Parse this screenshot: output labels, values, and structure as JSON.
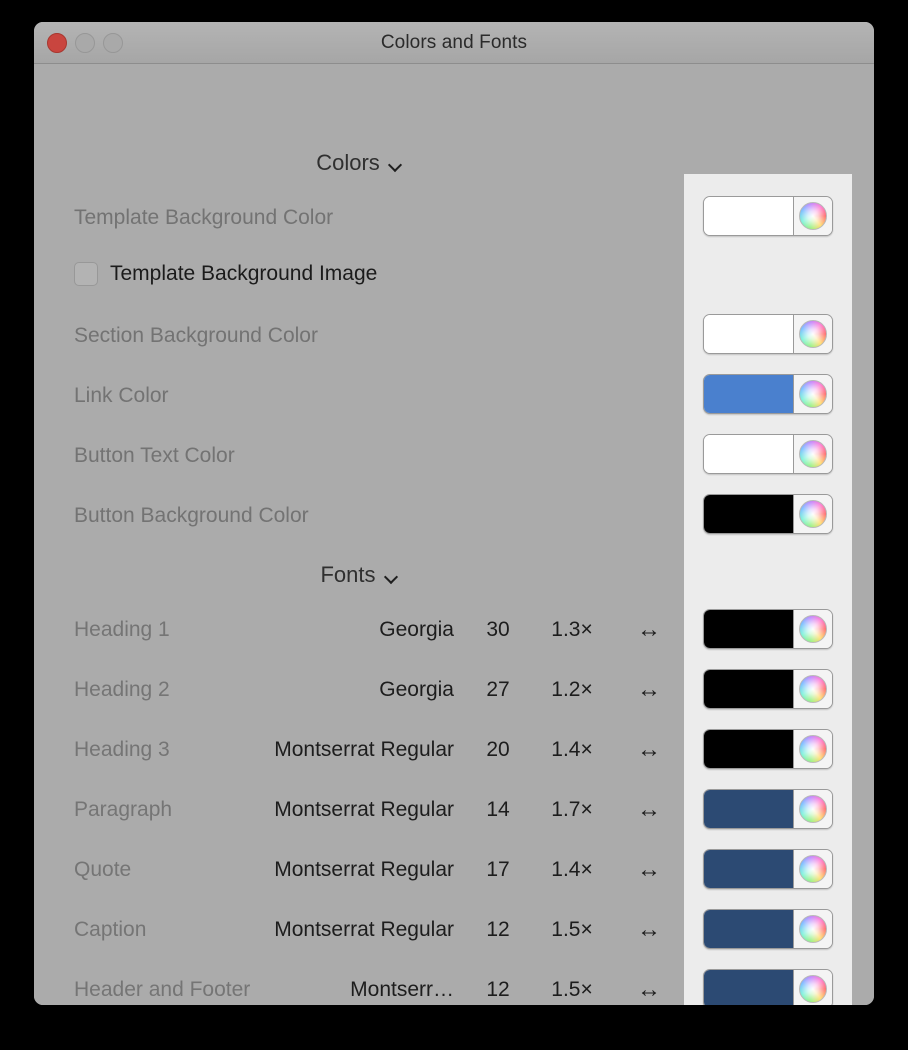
{
  "window": {
    "title": "Colors and Fonts",
    "traffic_lights": [
      "close",
      "minimize",
      "zoom"
    ]
  },
  "colors_section": {
    "header": "Colors",
    "chevron": "chevron-down-icon",
    "rows": [
      {
        "label": "Template Background Color",
        "type": "color",
        "value": "#ffffff"
      },
      {
        "label": "Template Background Image",
        "type": "checkbox",
        "checked": false
      },
      {
        "label": "Section Background Color",
        "type": "color",
        "value": "#ffffff"
      },
      {
        "label": "Link Color",
        "type": "color",
        "value": "#4a80ce"
      },
      {
        "label": "Button Text Color",
        "type": "color",
        "value": "#ffffff"
      },
      {
        "label": "Button Background Color",
        "type": "color",
        "value": "#000000"
      }
    ]
  },
  "fonts_section": {
    "header": "Fonts",
    "chevron": "chevron-down-icon",
    "rows": [
      {
        "label": "Heading 1",
        "family": "Georgia",
        "size": "30",
        "multiplier": "1.3×",
        "arrow": "↔",
        "color": "#000000"
      },
      {
        "label": "Heading 2",
        "family": "Georgia",
        "size": "27",
        "multiplier": "1.2×",
        "arrow": "↔",
        "color": "#000000"
      },
      {
        "label": "Heading 3",
        "family": "Montserrat Regular",
        "size": "20",
        "multiplier": "1.4×",
        "arrow": "↔",
        "color": "#000000"
      },
      {
        "label": "Paragraph",
        "family": "Montserrat Regular",
        "size": "14",
        "multiplier": "1.7×",
        "arrow": "↔",
        "color": "#2c4a73"
      },
      {
        "label": "Quote",
        "family": "Montserrat Regular",
        "size": "17",
        "multiplier": "1.4×",
        "arrow": "↔",
        "color": "#2c4a73"
      },
      {
        "label": "Caption",
        "family": "Montserrat Regular",
        "size": "12",
        "multiplier": "1.5×",
        "arrow": "↔",
        "color": "#2c4a73"
      },
      {
        "label": "Header and Footer",
        "family": "Montserr…",
        "size": "12",
        "multiplier": "1.5×",
        "arrow": "↔",
        "color": "#2c4a73"
      }
    ]
  }
}
